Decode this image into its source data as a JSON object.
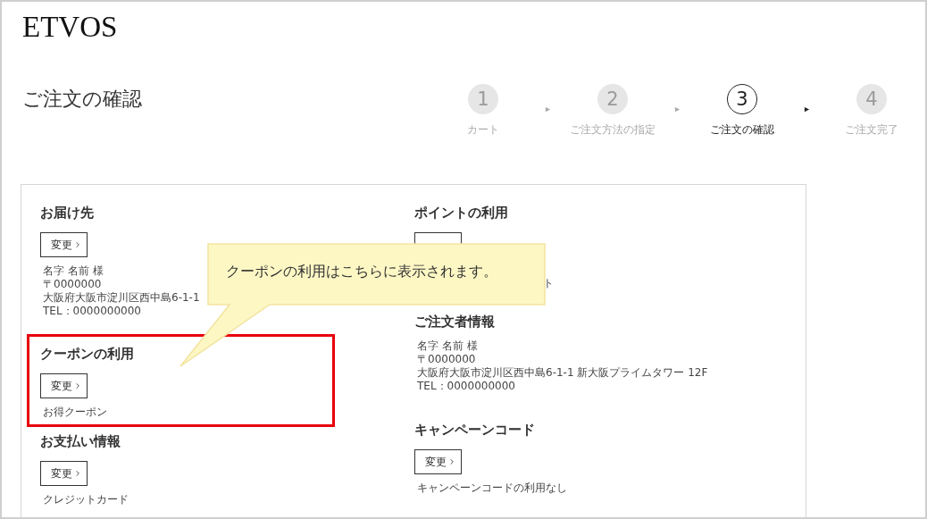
{
  "logo": "ETVOS",
  "title": "ご注文の確認",
  "steps": [
    {
      "number": "1",
      "label": "カート",
      "selected": false
    },
    {
      "number": "2",
      "label": "ご注文方法の指定",
      "selected": false
    },
    {
      "number": "3",
      "label": "ご注文の確認",
      "selected": true
    },
    {
      "number": "4",
      "label": "ご注文完了",
      "selected": false
    }
  ],
  "columns": [
    {
      "sections": [
        {
          "heading": "お届け先",
          "button": {
            "label": "変更"
          },
          "lines": [
            "名字 名前 様",
            "〒0000000",
            "大阪府大阪市淀川区西中島6-1-1",
            "TEL：0000000000"
          ],
          "highlighted": false
        },
        {
          "heading": "クーポンの利用",
          "button": {
            "label": "変更"
          },
          "lines": [
            "お得クーポン"
          ],
          "highlighted": true
        },
        {
          "heading": "お支払い情報",
          "button": {
            "label": "変更"
          },
          "lines": [
            "クレジットカード"
          ],
          "highlighted": false
        }
      ]
    },
    {
      "sections": [
        {
          "heading": "ポイントの利用",
          "button": {
            "label_hidden": true
          },
          "lines": [
            "ト"
          ],
          "highlighted": false,
          "kind": "covered"
        },
        {
          "heading": "ご注文者情報",
          "lines": [
            "名字 名前 様",
            "〒0000000",
            "大阪府大阪市淀川区西中島6-1-1 新大阪プライムタワー 12F",
            "TEL：0000000000"
          ],
          "highlighted": false
        },
        {
          "heading": "キャンペーンコード",
          "button": {
            "label": "変更"
          },
          "lines": [
            "キャンペーンコードの利用なし"
          ],
          "highlighted": false
        }
      ]
    }
  ],
  "callout": {
    "text": "クーポンの利用はこちらに表示されます。"
  }
}
